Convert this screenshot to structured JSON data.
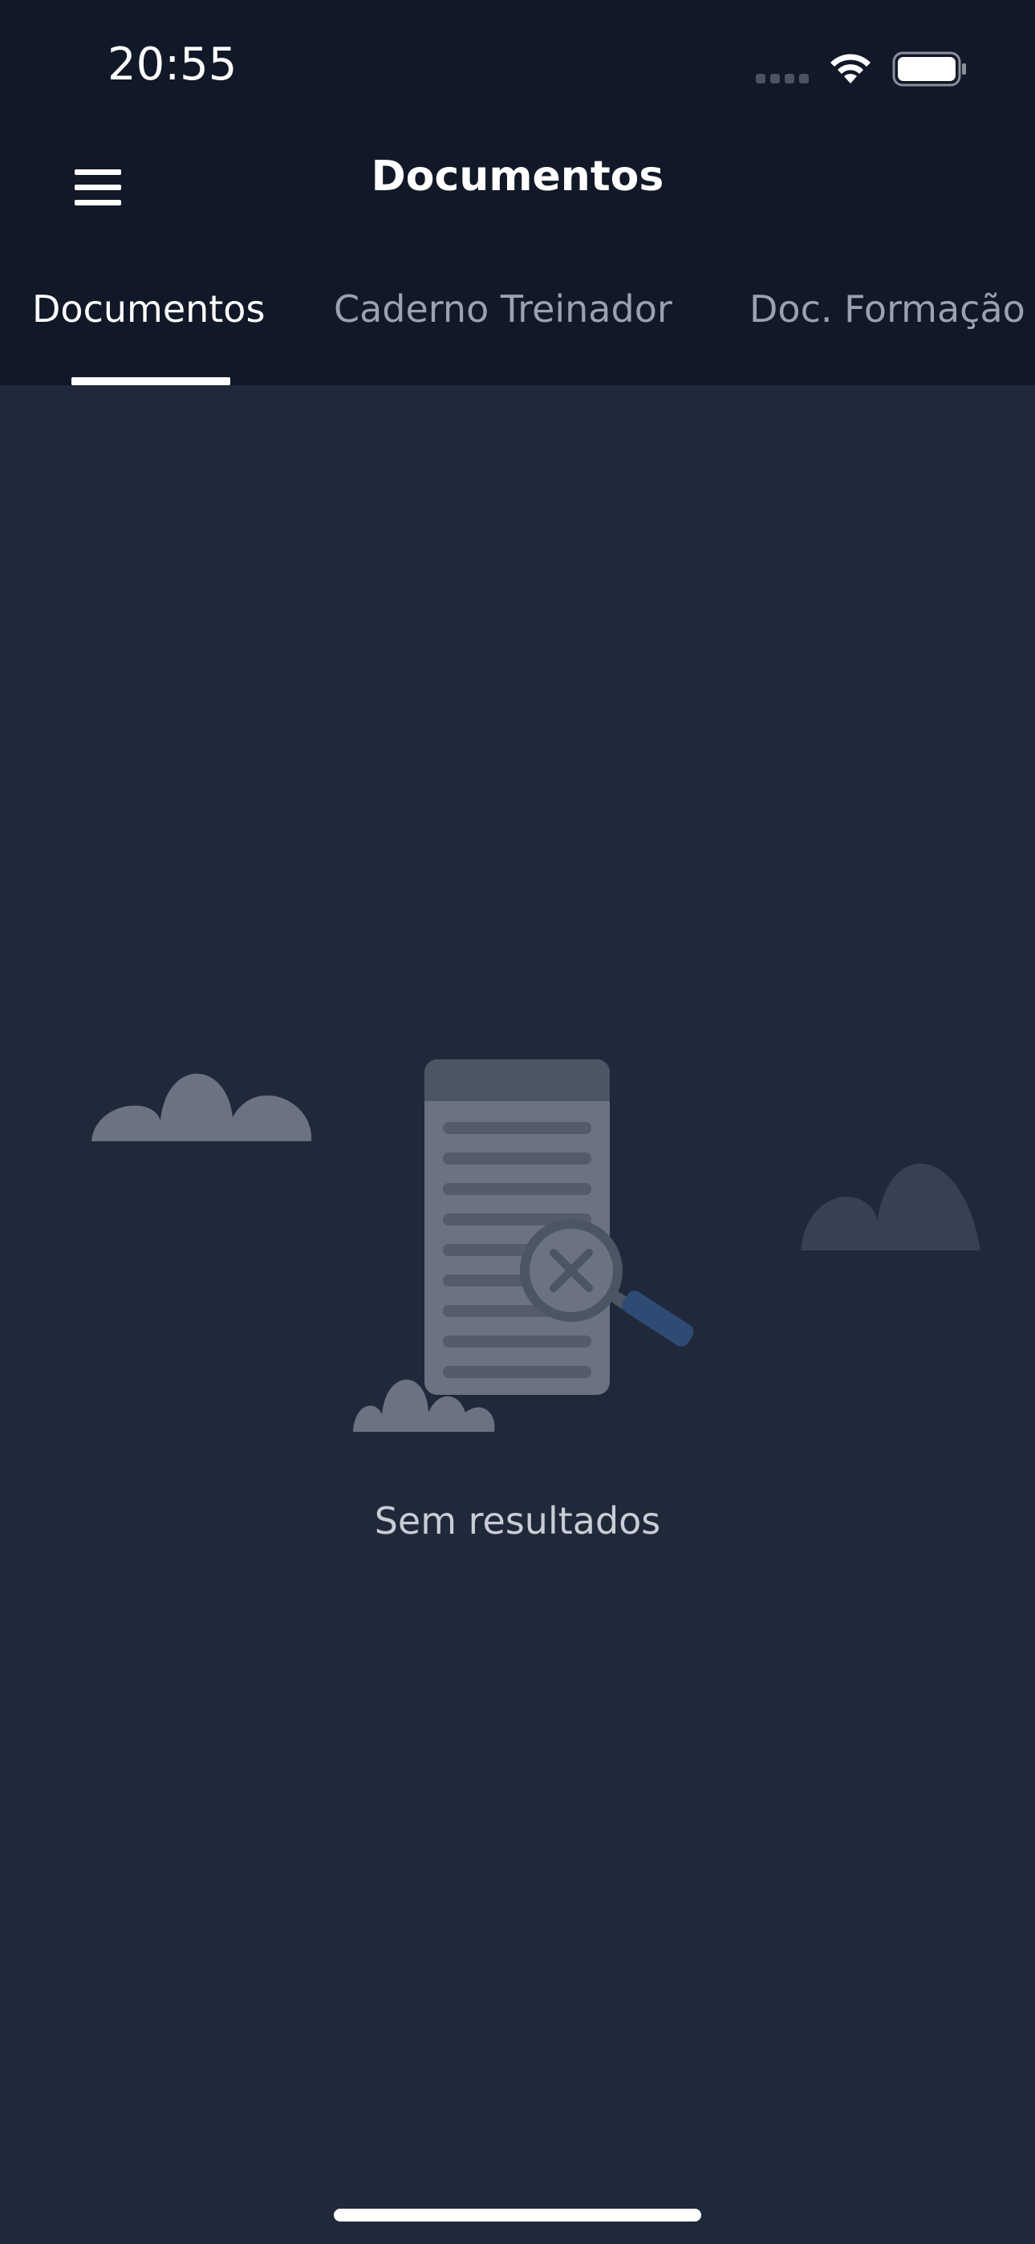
{
  "status_bar": {
    "time": "20:55"
  },
  "header": {
    "title": "Documentos"
  },
  "tabs": [
    {
      "label": "Documentos",
      "active": true
    },
    {
      "label": "Caderno Treinador",
      "active": false
    },
    {
      "label": "Doc. Formação",
      "active": false
    }
  ],
  "empty_state": {
    "message": "Sem resultados"
  },
  "colors": {
    "header_bg": "#111827",
    "content_bg": "#1f2939",
    "accent_handle": "#2f4a73"
  },
  "icons": {
    "menu": "hamburger-menu-icon",
    "wifi": "wifi-icon",
    "battery": "battery-icon",
    "signal": "cellular-signal-icon",
    "empty": "document-search-not-found-illustration"
  }
}
